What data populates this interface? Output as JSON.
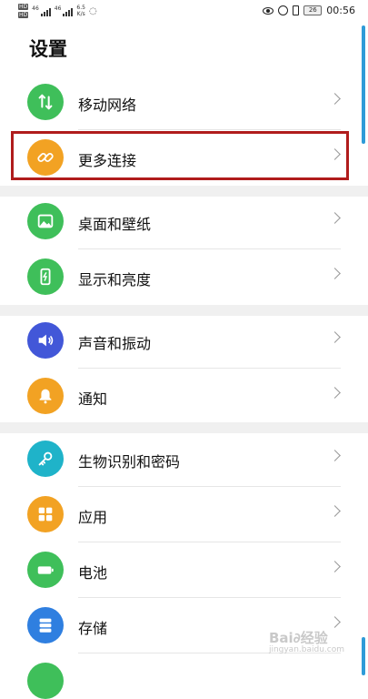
{
  "status_bar": {
    "sim1": "HD",
    "sim2": "HD",
    "net1": "46",
    "net2": "46",
    "speed_value": "6.5",
    "speed_unit": "K/s",
    "battery_level": "26",
    "time": "00:56"
  },
  "page": {
    "title": "设置"
  },
  "items": [
    {
      "label": "移动网络",
      "icon": "mobile-network-icon",
      "color": "#3fbf5a"
    },
    {
      "label": "更多连接",
      "icon": "link-icon",
      "color": "#f2a223"
    },
    {
      "label": "桌面和壁纸",
      "icon": "wallpaper-icon",
      "color": "#3fbf5a"
    },
    {
      "label": "显示和亮度",
      "icon": "display-brightness-icon",
      "color": "#3fbf5a"
    },
    {
      "label": "声音和振动",
      "icon": "speaker-icon",
      "color": "#4257d8"
    },
    {
      "label": "通知",
      "icon": "bell-icon",
      "color": "#f2a223"
    },
    {
      "label": "生物识别和密码",
      "icon": "key-icon",
      "color": "#1fb3c9"
    },
    {
      "label": "应用",
      "icon": "apps-grid-icon",
      "color": "#f2a223"
    },
    {
      "label": "电池",
      "icon": "battery-icon",
      "color": "#3fbf5a"
    },
    {
      "label": "存储",
      "icon": "storage-icon",
      "color": "#2f7fe0"
    }
  ],
  "watermark": {
    "main": "Bai∂经验",
    "sub": "jingyan.baidu.com"
  }
}
